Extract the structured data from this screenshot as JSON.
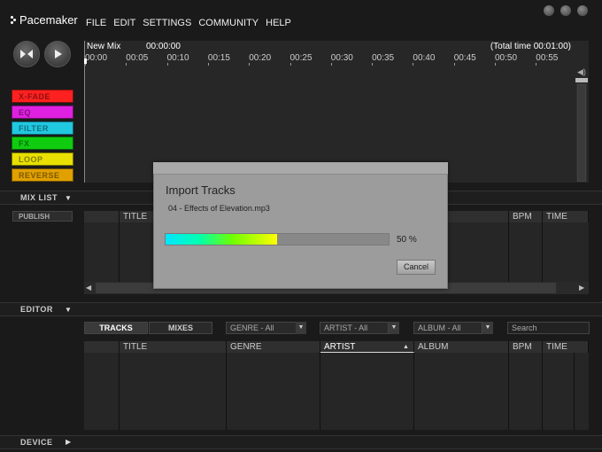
{
  "app": {
    "title": "Pacemaker",
    "menu": [
      "FILE",
      "EDIT",
      "SETTINGS",
      "COMMUNITY",
      "HELP"
    ]
  },
  "transport": {
    "skip_icon": "skip-icon",
    "play_icon": "play-icon"
  },
  "effects": [
    {
      "label": "X-FADE",
      "color": "#ff2020"
    },
    {
      "label": "EQ",
      "color": "#e020e0"
    },
    {
      "label": "FILTER",
      "color": "#20c8e0"
    },
    {
      "label": "FX",
      "color": "#10cc10"
    },
    {
      "label": "LOOP",
      "color": "#e8e000"
    },
    {
      "label": "REVERSE",
      "color": "#e0a000"
    }
  ],
  "timeline": {
    "mix_name": "New Mix",
    "current_time": "00:00:00",
    "total_time": "(Total time 00:01:00)",
    "ticks": [
      "00:00",
      "00:05",
      "00:10",
      "00:15",
      "00:20",
      "00:25",
      "00:30",
      "00:35",
      "00:40",
      "00:45",
      "00:50",
      "00:55"
    ]
  },
  "mixlist": {
    "label": "MIX LIST",
    "publish": "PUBLISH",
    "columns": {
      "title": "TITLE",
      "bpm": "BPM",
      "time": "TIME"
    }
  },
  "editor": {
    "label": "EDITOR",
    "tabs": [
      "TRACKS",
      "MIXES"
    ],
    "filters": {
      "genre": "GENRE - All",
      "artist": "ARTIST - All",
      "album": "ALBUM - All"
    },
    "search_placeholder": "Search",
    "columns": {
      "title": "TITLE",
      "genre": "GENRE",
      "artist": "ARTIST",
      "album": "ALBUM",
      "bpm": "BPM",
      "time": "TIME"
    }
  },
  "device": {
    "label": "DEVICE"
  },
  "dialog": {
    "title": "Import Tracks",
    "file": "04 - Effects of Elevation.mp3",
    "progress": 50,
    "progress_label": "50 %",
    "cancel": "Cancel"
  }
}
